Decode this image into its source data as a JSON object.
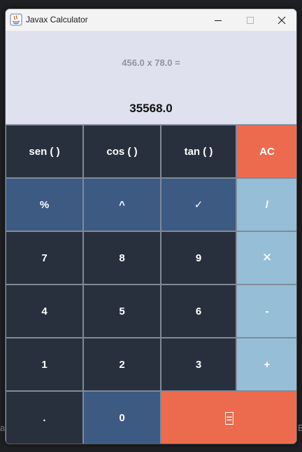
{
  "window": {
    "title": "Javax Calculator"
  },
  "display": {
    "expression": "456.0 x 78.0 =",
    "result": "35568.0"
  },
  "keys": {
    "sin": "sen ( )",
    "cos": "cos ( )",
    "tan": "tan ( )",
    "clear": "AC",
    "percent": "%",
    "power": "^",
    "sqrt": "✓",
    "divide": "/",
    "seven": "7",
    "eight": "8",
    "nine": "9",
    "multiply": "✕",
    "four": "4",
    "five": "5",
    "six": "6",
    "minus": "-",
    "one": "1",
    "two": "2",
    "three": "3",
    "plus": "+",
    "dot": ".",
    "zero": "0",
    "equals": "="
  },
  "colors": {
    "dark_key": "#28303e",
    "blue_key": "#3c5a82",
    "light_key": "#97bed7",
    "orange_key": "#ec6b4e",
    "display_bg": "#dfe1ee"
  }
}
